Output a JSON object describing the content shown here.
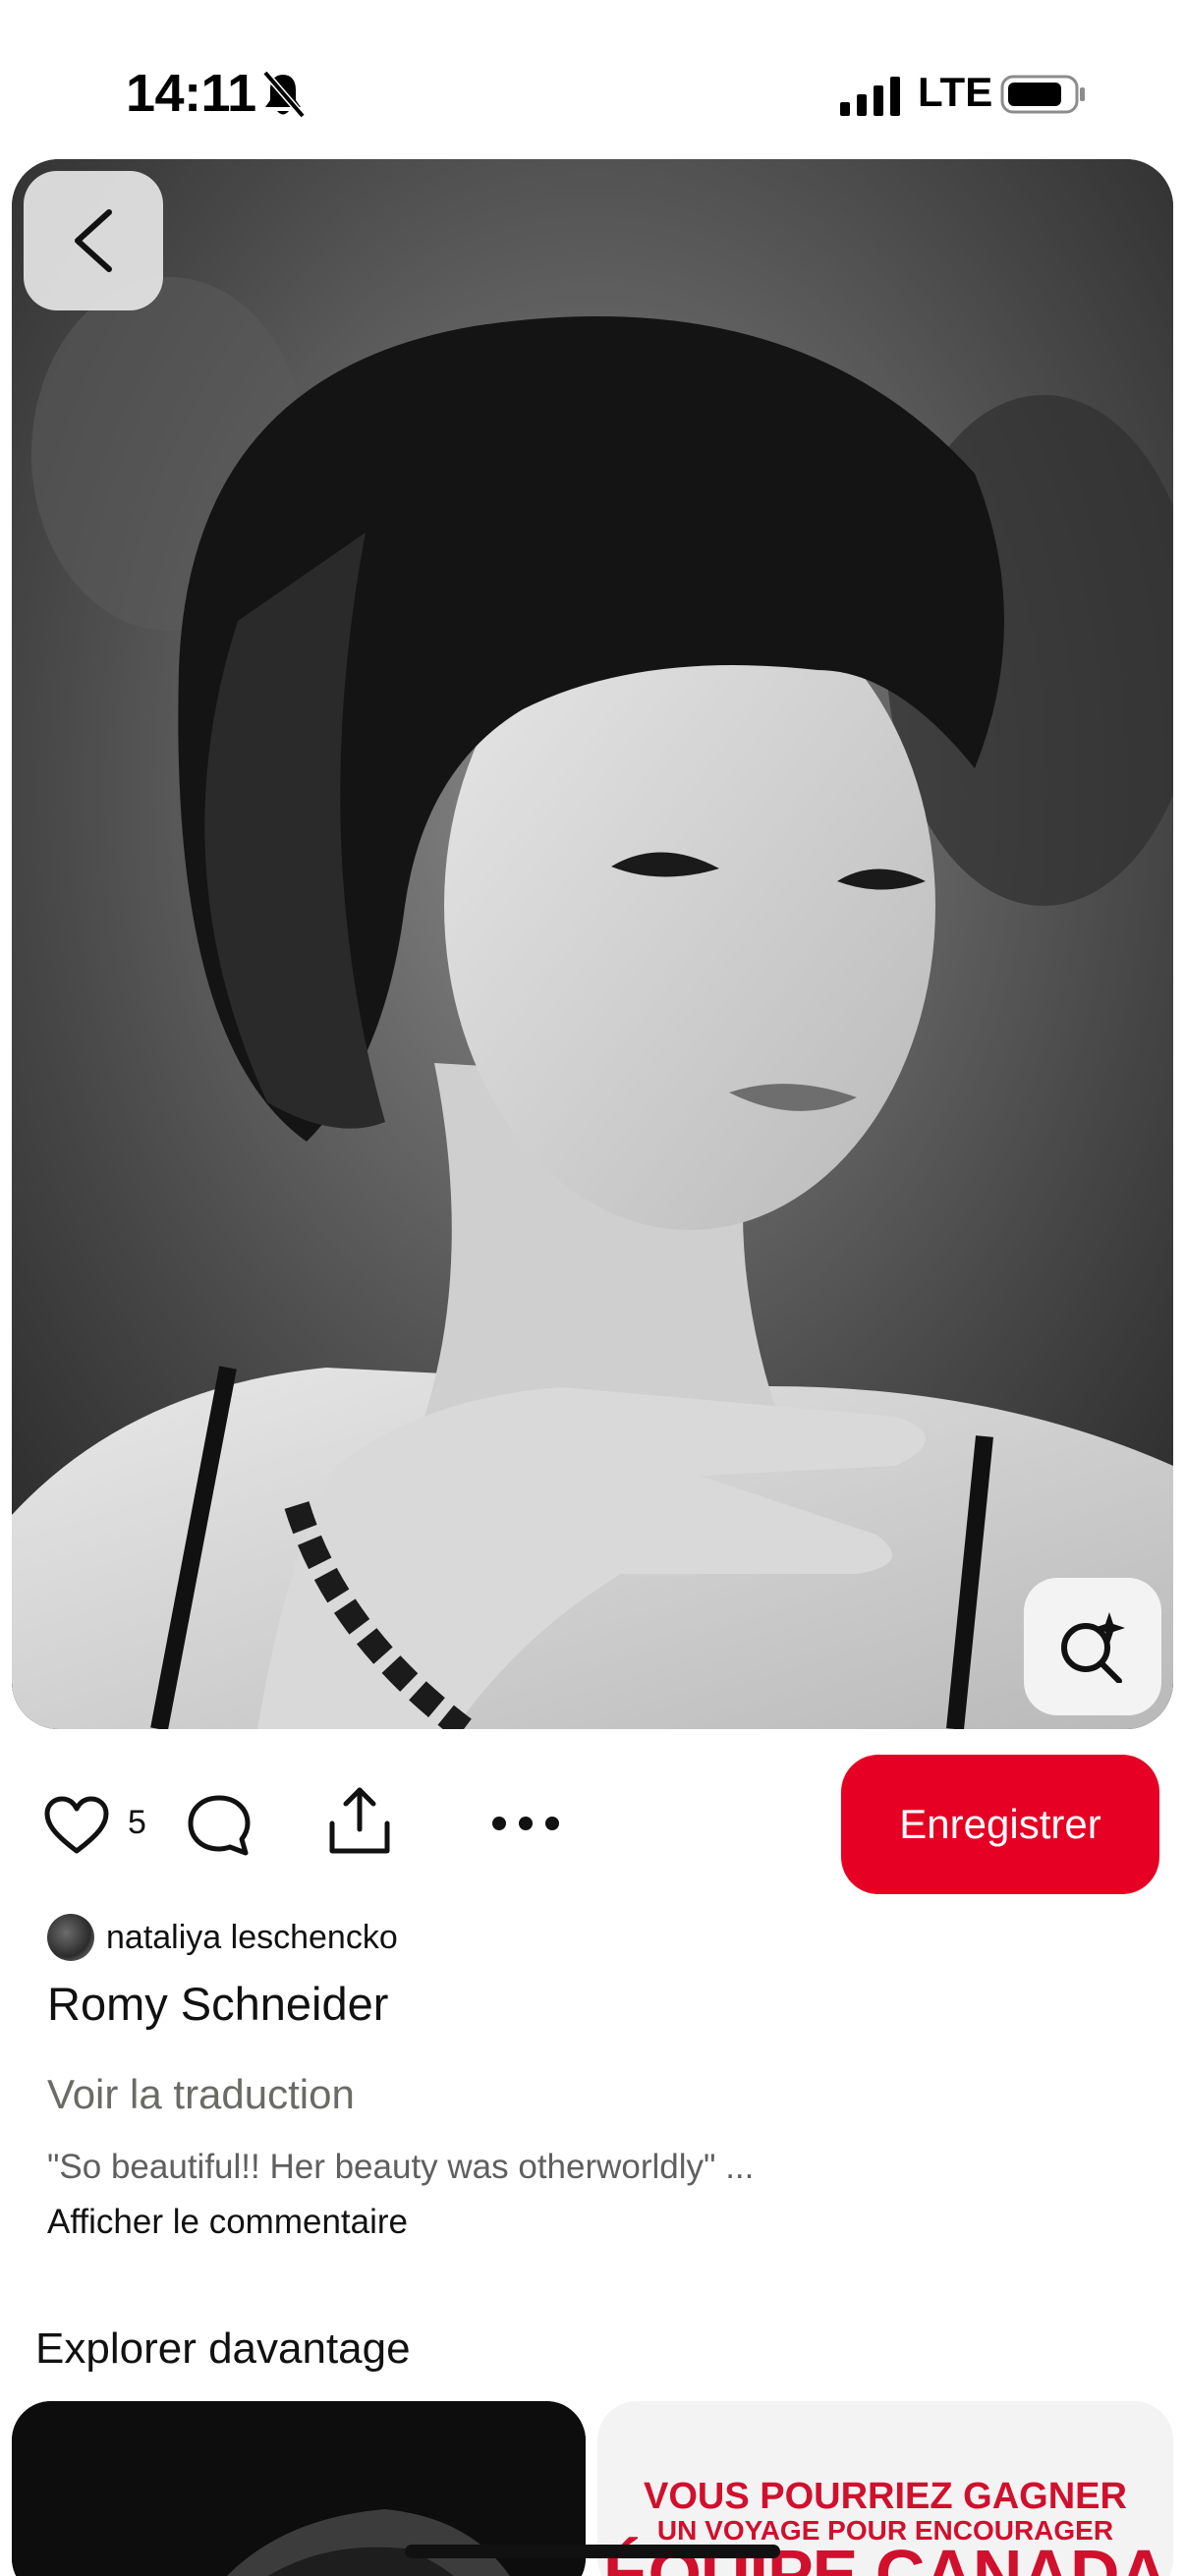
{
  "status_bar": {
    "time": "14:11",
    "network": "LTE"
  },
  "pin": {
    "like_count": "5",
    "save_label": "Enregistrer",
    "author_name": "nataliya leschencko",
    "title": "Romy Schneider",
    "translate_label": "Voir la traduction",
    "comment_preview": "\"So beautiful!! Her beauty was otherworldly\" ...",
    "show_comment_label": "Afficher le commentaire"
  },
  "explore": {
    "title": "Explorer davantage",
    "ad_card": {
      "line1": "VOUS POURRIEZ GAGNER",
      "line2": "UN VOYAGE POUR ENCOURAGER",
      "line3": "ÉQUIPE CANADA"
    }
  },
  "icons": {
    "back": "chevron-left-icon",
    "lens": "visual-search-icon",
    "like": "heart-icon",
    "comment": "comment-bubble-icon",
    "share": "share-upload-icon",
    "more": "more-horizontal-icon"
  },
  "colors": {
    "brand_red": "#e60023",
    "secondary_text": "#6b6b66"
  }
}
